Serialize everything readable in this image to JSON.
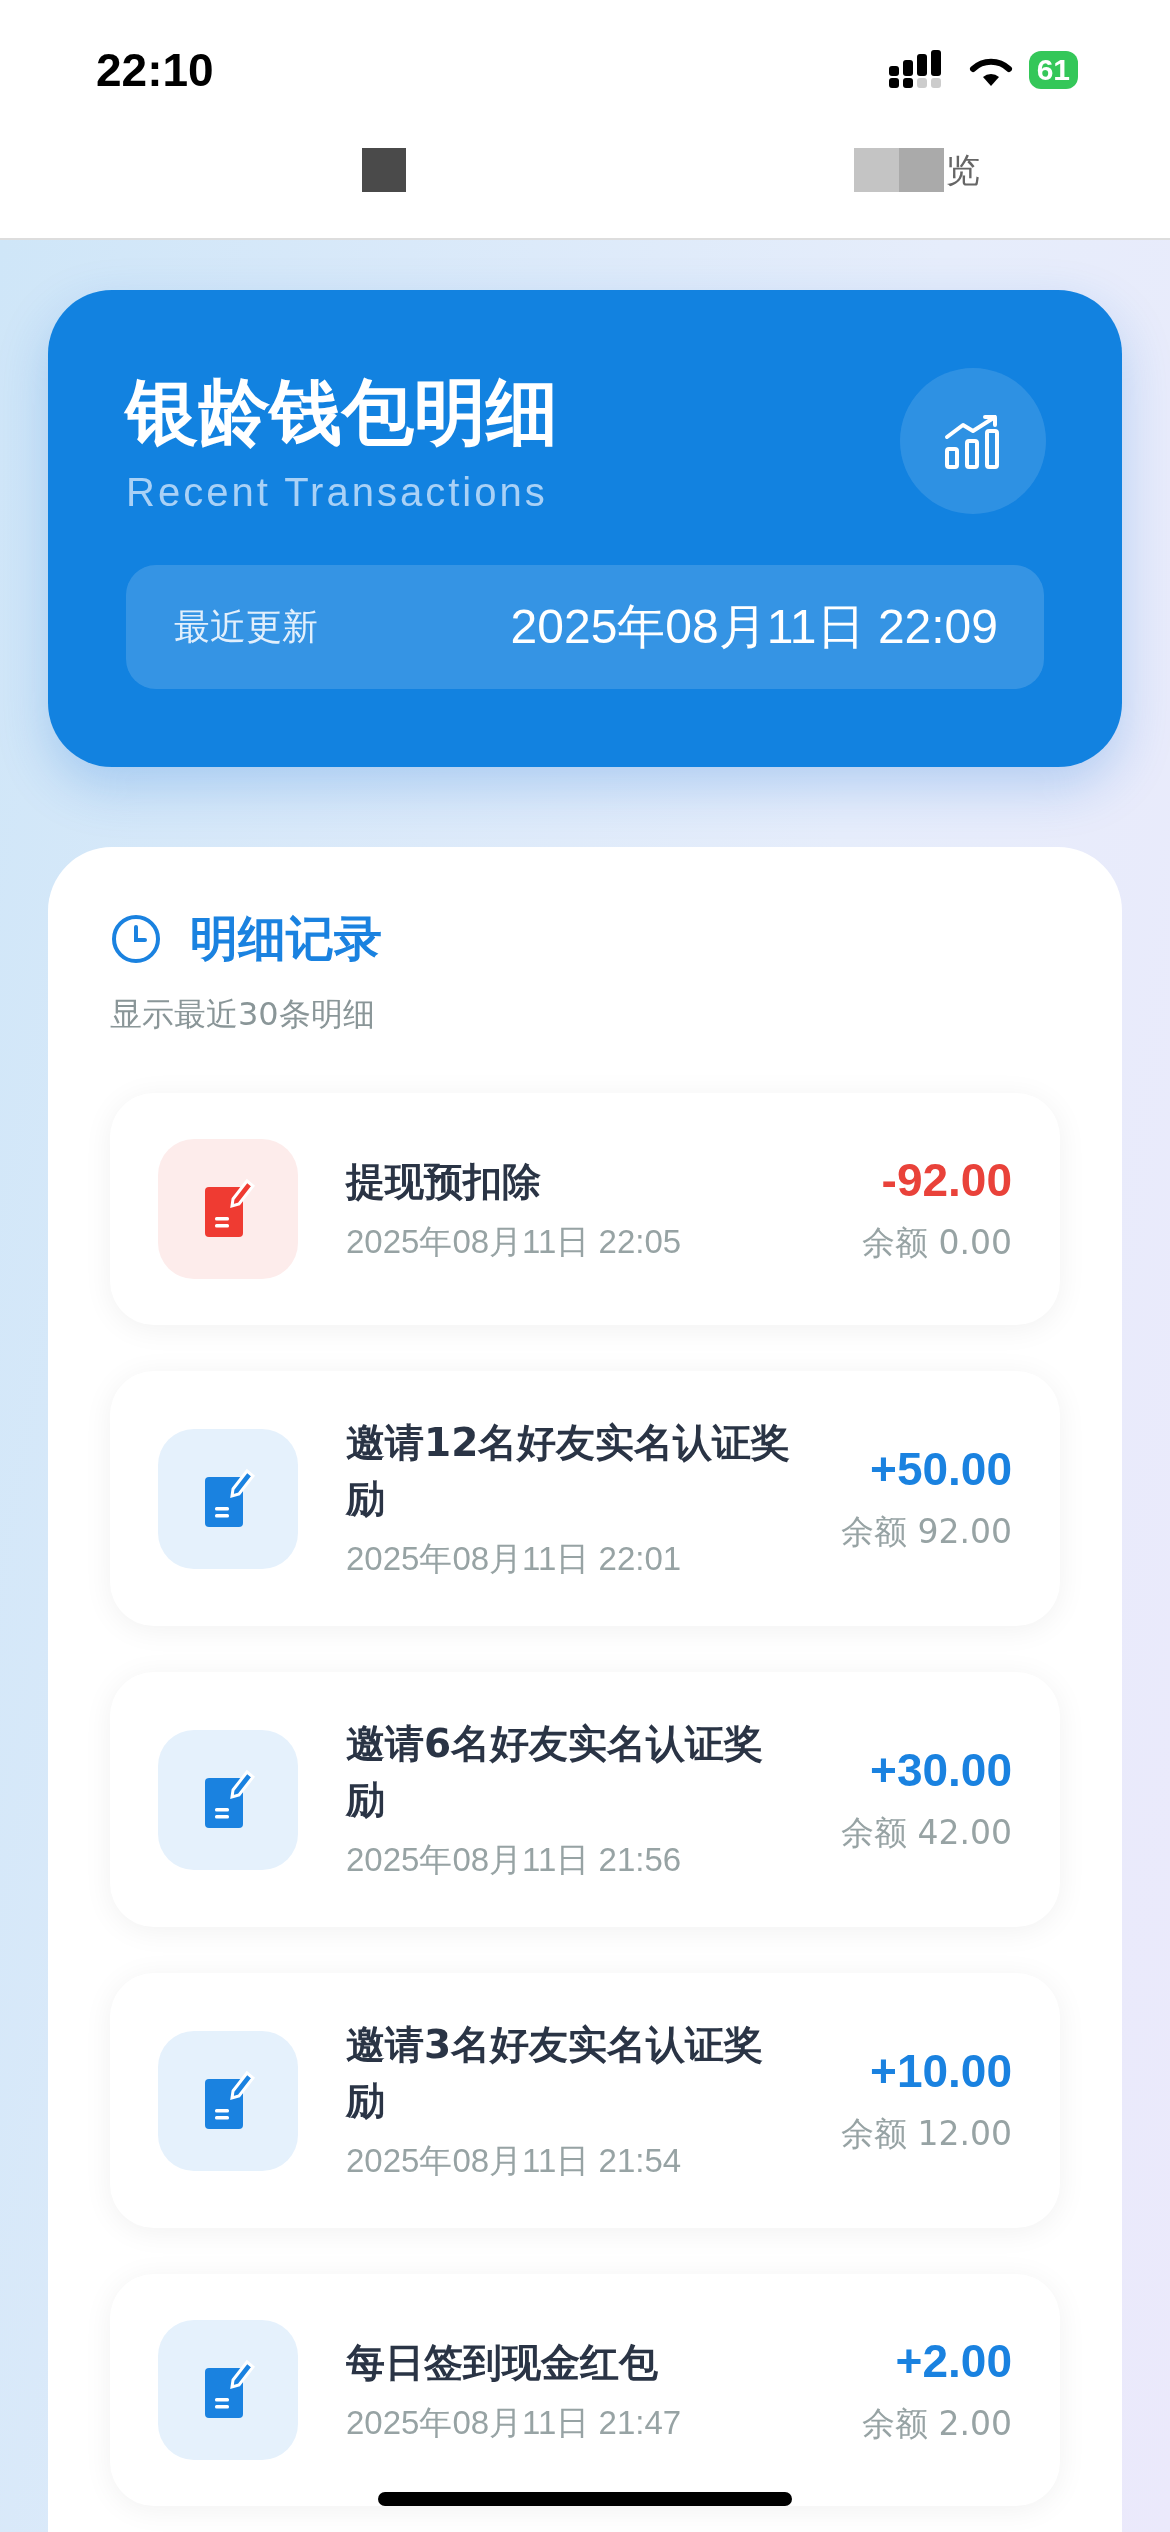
{
  "status_bar": {
    "time": "22:10",
    "battery": "61"
  },
  "nav": {
    "title_fragment": "览"
  },
  "header": {
    "title": "银龄钱包明细",
    "subtitle": "Recent Transactions",
    "update_label": "最近更新",
    "update_time": "2025年08月11日 22:09"
  },
  "records": {
    "title": "明细记录",
    "subtitle": "显示最近30条明细",
    "items": [
      {
        "kind": "debit",
        "title": "提现预扣除",
        "time": "2025年08月11日 22:05",
        "amount": "-92.00",
        "balance": "余额 0.00"
      },
      {
        "kind": "credit",
        "title": "邀请12名好友实名认证奖励",
        "time": "2025年08月11日 22:01",
        "amount": "+50.00",
        "balance": "余额 92.00"
      },
      {
        "kind": "credit",
        "title": "邀请6名好友实名认证奖励",
        "time": "2025年08月11日 21:56",
        "amount": "+30.00",
        "balance": "余额 42.00"
      },
      {
        "kind": "credit",
        "title": "邀请3名好友实名认证奖励",
        "time": "2025年08月11日 21:54",
        "amount": "+10.00",
        "balance": "余额 12.00"
      },
      {
        "kind": "credit",
        "title": "每日签到现金红包",
        "time": "2025年08月11日 21:47",
        "amount": "+2.00",
        "balance": "余额 2.00"
      }
    ]
  }
}
